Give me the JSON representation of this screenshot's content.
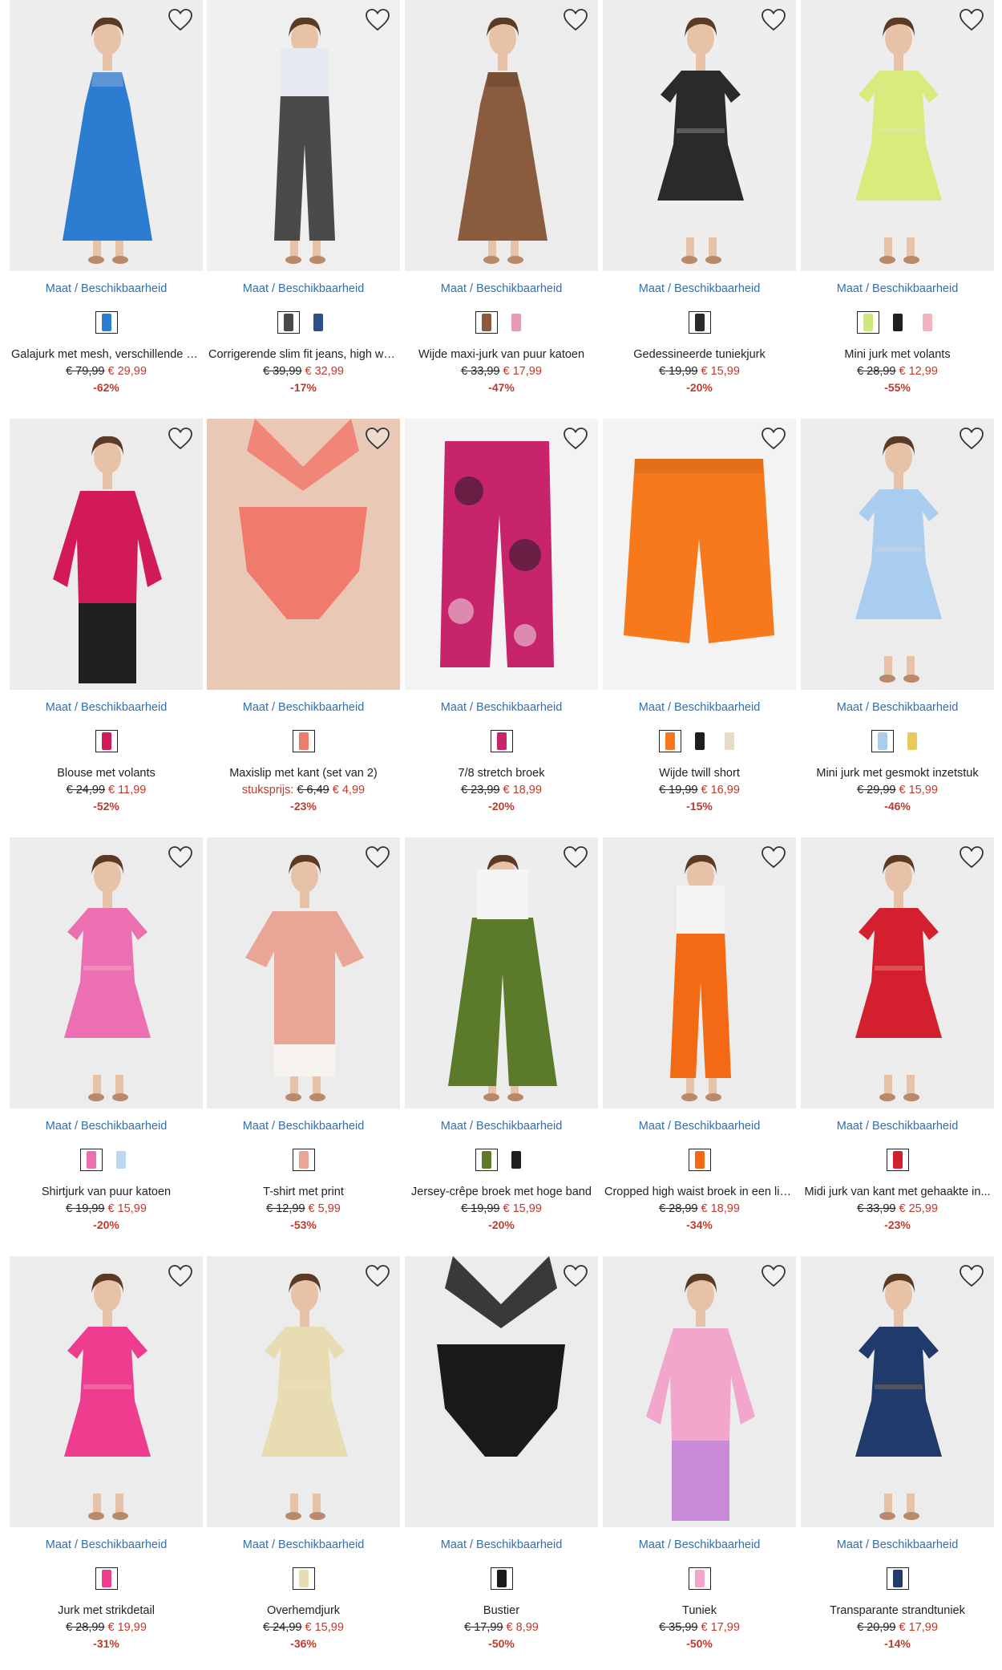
{
  "size_label": "Maat / Beschikbaarheid",
  "products": [
    {
      "title": "Galajurk met mesh, verschillende d...",
      "old_price": "€ 79,99",
      "new_price": "€ 29,99",
      "discount": "-62%",
      "bg": "#ededed",
      "item": "#2c7dd2",
      "item2": "#f1e3d3",
      "type": "longdress",
      "swatches": [
        "#2c7dd2"
      ]
    },
    {
      "title": "Corrigerende slim fit jeans, high wa...",
      "old_price": "€ 39,99",
      "new_price": "€ 32,99",
      "discount": "-17%",
      "bg": "#efefef",
      "item": "#4a4a4a",
      "item2": "#e6e9ef",
      "type": "pants",
      "swatches": [
        "#4a4a4a",
        "#2c4f8c"
      ]
    },
    {
      "title": "Wijde maxi-jurk van puur katoen",
      "old_price": "€ 33,99",
      "new_price": "€ 17,99",
      "discount": "-47%",
      "bg": "#ececec",
      "item": "#8a5b3c",
      "item2": "#3a2a1e",
      "type": "longdress",
      "swatches": [
        "#8a5b3c",
        "#e99ab8"
      ]
    },
    {
      "title": "Gedessineerde tuniekjurk",
      "old_price": "€ 19,99",
      "new_price": "€ 15,99",
      "discount": "-20%",
      "bg": "#eeeeee",
      "item": "#2a2a2a",
      "item2": "#f0f0f0",
      "type": "dress",
      "swatches": [
        "#2a2a2a"
      ]
    },
    {
      "title": "Mini jurk met volants",
      "old_price": "€ 28,99",
      "new_price": "€ 12,99",
      "discount": "-55%",
      "bg": "#ededed",
      "item": "#d7ec7c",
      "item2": "#f1e3d3",
      "type": "dress",
      "swatches": [
        "#cfe87a",
        "#1f1f1f",
        "#f2b4c0"
      ]
    },
    {
      "title": "Blouse met volants",
      "old_price": "€ 24,99",
      "new_price": "€ 11,99",
      "discount": "-52%",
      "bg": "#ececec",
      "item": "#d11a56",
      "item2": "#1f1f1f",
      "type": "blouse",
      "swatches": [
        "#d11a56"
      ]
    },
    {
      "title": "Maxislip met kant (set van 2)",
      "prefix": "stuksprijs:",
      "old_price": "€ 6,49",
      "new_price": "€ 4,99",
      "discount": "-23%",
      "bg": "#e9c9b6",
      "item": "#f07a6c",
      "item2": "#e9c9b6",
      "type": "lingerie",
      "swatches": [
        "#f07a6c"
      ]
    },
    {
      "title": "7/8 stretch broek",
      "old_price": "€ 23,99",
      "new_price": "€ 18,99",
      "discount": "-20%",
      "bg": "#f3f3f3",
      "item": "#c7246b",
      "item2": "#2a1a2a",
      "type": "flatpants",
      "swatches": [
        "#c7246b"
      ]
    },
    {
      "title": "Wijde twill short",
      "old_price": "€ 19,99",
      "new_price": "€ 16,99",
      "discount": "-15%",
      "bg": "#f3f3f3",
      "item": "#f7791c",
      "item2": "#f7791c",
      "type": "shorts",
      "swatches": [
        "#f7791c",
        "#1f1f1f",
        "#e8dcc7"
      ]
    },
    {
      "title": "Mini jurk met gesmokt inzetstuk",
      "old_price": "€ 29,99",
      "new_price": "€ 15,99",
      "discount": "-46%",
      "bg": "#ececec",
      "item": "#a8cdef",
      "item2": "#f1e3d3",
      "type": "dress",
      "swatches": [
        "#a8cdef",
        "#e9c95c"
      ]
    },
    {
      "title": "Shirtjurk van puur katoen",
      "old_price": "€ 19,99",
      "new_price": "€ 15,99",
      "discount": "-20%",
      "bg": "#ececec",
      "item": "#ec6fb2",
      "item2": "#f1e3d3",
      "type": "dress",
      "swatches": [
        "#ec6fb2",
        "#bcd7f0"
      ]
    },
    {
      "title": "T-shirt met print",
      "old_price": "€ 12,99",
      "new_price": "€ 5,99",
      "discount": "-53%",
      "bg": "#ececec",
      "item": "#e9a596",
      "item2": "#f7f3ee",
      "type": "tshirt",
      "swatches": [
        "#e9a596"
      ]
    },
    {
      "title": "Jersey-crêpe broek met hoge band",
      "old_price": "€ 19,99",
      "new_price": "€ 15,99",
      "discount": "-20%",
      "bg": "#ededed",
      "item": "#5b7a2a",
      "item2": "#f5f5f5",
      "type": "widepants",
      "swatches": [
        "#5b7a2a",
        "#1f1f1f"
      ]
    },
    {
      "title": "Cropped high waist broek in een lin...",
      "old_price": "€ 28,99",
      "new_price": "€ 18,99",
      "discount": "-34%",
      "bg": "#ececec",
      "item": "#f46a14",
      "item2": "#f5f5f5",
      "type": "pants",
      "swatches": [
        "#f46a14"
      ]
    },
    {
      "title": "Midi jurk van kant met gehaakte in...",
      "old_price": "€ 33,99",
      "new_price": "€ 25,99",
      "discount": "-23%",
      "bg": "#ececec",
      "item": "#d4202e",
      "item2": "#f1e3d3",
      "type": "dress",
      "swatches": [
        "#d4202e"
      ]
    },
    {
      "title": "Jurk met strikdetail",
      "old_price": "€ 28,99",
      "new_price": "€ 19,99",
      "discount": "-31%",
      "bg": "#ececec",
      "item": "#ee3d8f",
      "item2": "#f1e3d3",
      "type": "dress",
      "swatches": [
        "#ee3d8f"
      ]
    },
    {
      "title": "Overhemdjurk",
      "old_price": "€ 24,99",
      "new_price": "€ 15,99",
      "discount": "-36%",
      "bg": "#ececec",
      "item": "#e8dcb2",
      "item2": "#f1e3d3",
      "type": "dress",
      "swatches": [
        "#e8dcb2"
      ]
    },
    {
      "title": "Bustier",
      "old_price": "€ 17,99",
      "new_price": "€ 8,99",
      "discount": "-50%",
      "bg": "#ececec",
      "item": "#1a1a1a",
      "item2": "#f1e3d3",
      "type": "lingerie",
      "swatches": [
        "#1a1a1a"
      ]
    },
    {
      "title": "Tuniek",
      "old_price": "€ 35,99",
      "new_price": "€ 17,99",
      "discount": "-50%",
      "bg": "#ececec",
      "item": "#f3a6cc",
      "item2": "#c98bd8",
      "type": "blouse",
      "swatches": [
        "#f3a6cc"
      ]
    },
    {
      "title": "Transparante strandtuniek",
      "old_price": "€ 20,99",
      "new_price": "€ 17,99",
      "discount": "-14%",
      "bg": "#ececec",
      "item": "#1f3a6b",
      "item2": "#e6a23c",
      "type": "dress",
      "swatches": [
        "#1f3a6b"
      ]
    }
  ]
}
